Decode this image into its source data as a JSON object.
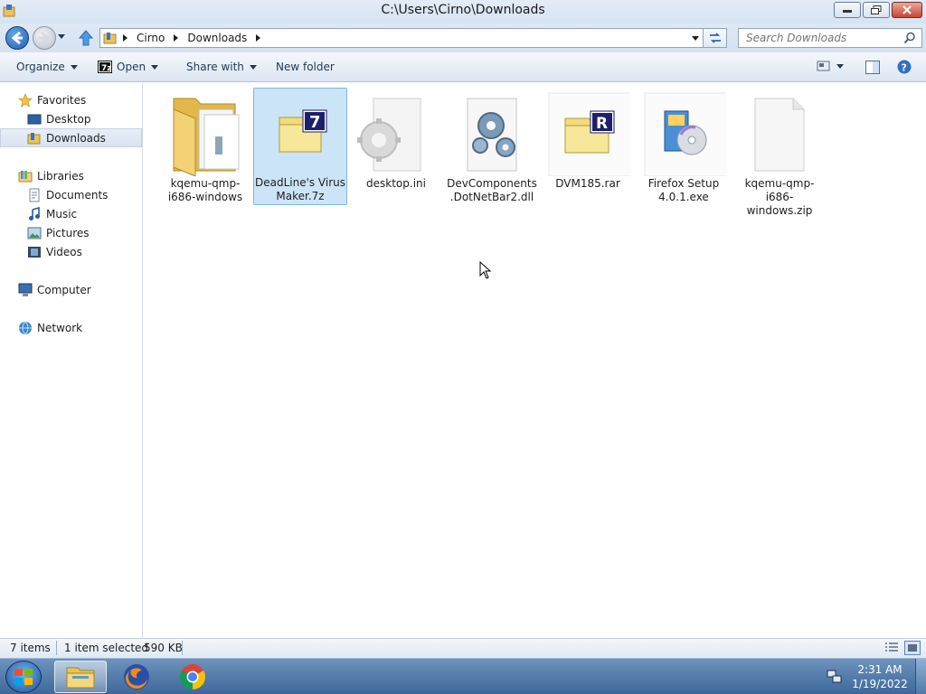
{
  "window": {
    "title": "C:\\Users\\Cirno\\Downloads"
  },
  "address": {
    "crumbs": [
      "Cirno",
      "Downloads"
    ]
  },
  "search": {
    "placeholder": "Search Downloads"
  },
  "toolbar": {
    "organize": "Organize",
    "open": "Open",
    "share_with": "Share with",
    "new_folder": "New folder"
  },
  "nav": {
    "favorites": "Favorites",
    "desktop": "Desktop",
    "downloads": "Downloads",
    "libraries": "Libraries",
    "documents": "Documents",
    "music": "Music",
    "pictures": "Pictures",
    "videos": "Videos",
    "computer": "Computer",
    "network": "Network"
  },
  "files": [
    {
      "name": "kqemu-qmp-i686-windows",
      "icon": "folder-icon"
    },
    {
      "name": "DeadLine's Virus Maker.7z",
      "icon": "7z-archive-icon",
      "selected": true
    },
    {
      "name": "desktop.ini",
      "icon": "ini-config-icon"
    },
    {
      "name": "DevComponents.DotNetBar2.dll",
      "icon": "dll-gears-icon"
    },
    {
      "name": "DVM185.rar",
      "icon": "rar-archive-icon"
    },
    {
      "name": "Firefox Setup 4.0.1.exe",
      "icon": "installer-icon"
    },
    {
      "name": "kqemu-qmp-i686-windows.zip",
      "icon": "blank-file-icon"
    }
  ],
  "status": {
    "item_count": "7 items",
    "selection": "1 item selected",
    "size": "590 KB"
  },
  "taskbar": {
    "time": "2:31 AM",
    "date": "1/19/2022"
  },
  "colors": {
    "selection": "#cce4f7",
    "selection_border": "#7eb4ea",
    "taskbar": "#4a74a3"
  }
}
